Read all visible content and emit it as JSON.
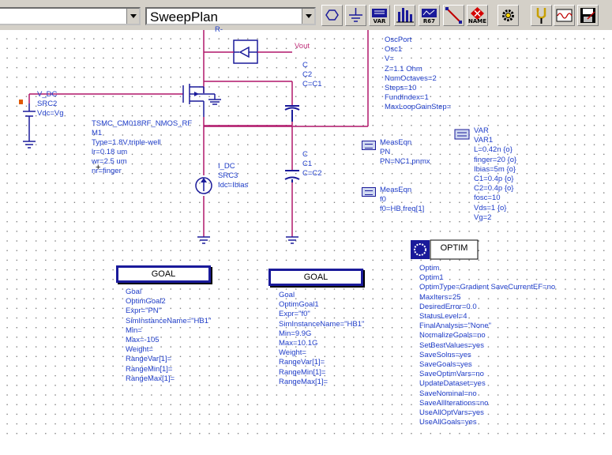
{
  "toolbar": {
    "combo_left_value": "",
    "combo_sweepplan_value": "SweepPlan",
    "icons": [
      {
        "name": "port-icon",
        "label": ""
      },
      {
        "name": "ground-icon",
        "label": ""
      },
      {
        "name": "var-icon",
        "label": "VAR"
      },
      {
        "name": "display-bars-icon",
        "label": ""
      },
      {
        "name": "readout-icon",
        "label": "R67"
      },
      {
        "name": "wire-icon",
        "label": ""
      },
      {
        "name": "name-icon",
        "label": "NAME"
      },
      {
        "name": "settings-gear-icon",
        "label": ""
      },
      {
        "name": "tuning-fork-icon",
        "label": ""
      },
      {
        "name": "waveform-icon",
        "label": ""
      },
      {
        "name": "save-disk-icon",
        "label": ""
      }
    ]
  },
  "schematic": {
    "vout_label": "Vout",
    "r_minus_label": "R-",
    "plus_marker": "+",
    "v_dc": {
      "type": "V_DC",
      "name": "SRC2",
      "param": "Vdc=Vg"
    },
    "mosfet": {
      "model": "TSMC_CM018RF_NMOS_RF",
      "name": "M1",
      "type": "Type=1.8V,triple-well",
      "lr": "lr=0.18 um",
      "wr": "wr=2.5 um",
      "nr": "nr=finger"
    },
    "i_dc": {
      "type": "I_DC",
      "name": "SRC3",
      "param": "Idc=Ibias"
    },
    "cap_c2": {
      "type": "C",
      "name": "C2",
      "param": "C=C1"
    },
    "cap_c1": {
      "type": "C",
      "name": "C1",
      "param": "C=C2"
    },
    "oscport": {
      "type": "OscPort",
      "name": "Osc1",
      "lines": [
        "V=",
        "Z=1.1 Ohm",
        "NumOctaves=2",
        "Steps=10",
        "FundIndex=1",
        "MaxLoopGainStep="
      ]
    },
    "meas_pn": {
      "type": "MeasEqn",
      "name": "PN",
      "expr": "PN=NC1.pnmx"
    },
    "meas_f0": {
      "type": "MeasEqn",
      "name": "f0",
      "expr": "f0=HB.freq[1]"
    },
    "var": {
      "type": "VAR",
      "name": "VAR1",
      "lines": [
        "L=0.42n {o}",
        "finger=20 {o}",
        "Ibias=5m {o}",
        "C1=0.4p {o}",
        "C2=0.4p {o}",
        "fosc=10",
        "Vds=1 {o}",
        "Vg=2"
      ]
    },
    "goal_left": {
      "box_label": "GOAL",
      "lines": [
        "Goal",
        "OptimGoal2",
        "Expr=\"PN\"",
        "SimInstanceName=\"HB1\"",
        "Min=",
        "Max=-105",
        "Weight=",
        "RangeVar[1]=",
        "RangeMin[1]=",
        "RangeMax[1]="
      ]
    },
    "goal_right": {
      "box_label": "GOAL",
      "lines": [
        "Goal",
        "OptimGoal1",
        "Expr=\"f0\"",
        "SimInstanceName=\"HB1\"",
        "Min=9.9G",
        "Max=10.1G",
        "Weight=",
        "RangeVar[1]=",
        "RangeMin[1]=",
        "RangeMax[1]="
      ]
    },
    "optim": {
      "box_label": "OPTIM",
      "lines": [
        "Optim",
        "Optim1",
        "OptimType=Gradient   SaveCurrentEF=no",
        "MaxIters=25",
        "DesiredError=0.0",
        "StatusLevel=4",
        "FinalAnalysis=\"None\"",
        "NormalizeGoals=no",
        "SetBestValues=yes",
        "SaveSolns=yes",
        "SaveGoals=yes",
        "SaveOptimVars=no",
        "UpdateDataset=yes",
        "SaveNominal=no",
        "SaveAllIterations=no",
        "UseAllOptVars=yes",
        "UseAllGoals=yes"
      ]
    }
  },
  "colors": {
    "wire": "#b0176a",
    "component": "#1a1a9a",
    "label": "#1e3cc8",
    "port_marker": "#e05a00"
  }
}
